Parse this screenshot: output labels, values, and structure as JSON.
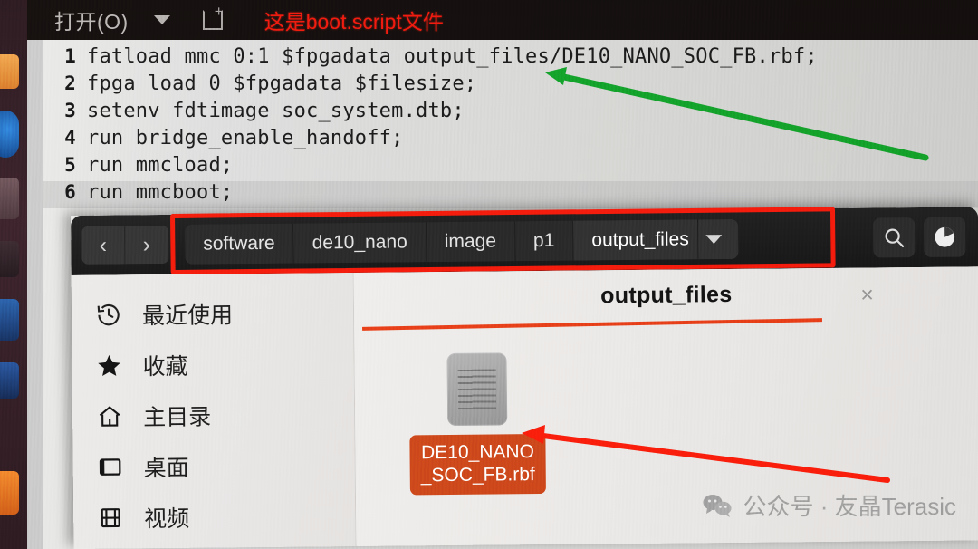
{
  "editor": {
    "toolbar": {
      "open_label": "打开(O)",
      "dropdown_icon": "chevron-down-icon",
      "new_document_icon": "new-document-icon"
    },
    "annotation_title": "这是boot.script文件",
    "code_lines": [
      {
        "num": "1",
        "text": "fatload mmc 0:1 $fpgadata output_files/DE10_NANO_SOC_FB.rbf;"
      },
      {
        "num": "2",
        "text": "fpga load 0 $fpgadata $filesize;"
      },
      {
        "num": "3",
        "text": "setenv fdtimage soc_system.dtb;"
      },
      {
        "num": "4",
        "text": "run bridge_enable_handoff;"
      },
      {
        "num": "5",
        "text": "run mmcload;"
      },
      {
        "num": "6",
        "text": "run mmcboot;"
      }
    ]
  },
  "filemanager": {
    "nav": {
      "back_icon": "chevron-left-icon",
      "back_label": "‹",
      "forward_icon": "chevron-right-icon",
      "forward_label": "›"
    },
    "breadcrumb": [
      {
        "label": "software",
        "current": false
      },
      {
        "label": "de10_nano",
        "current": false
      },
      {
        "label": "image",
        "current": false
      },
      {
        "label": "p1",
        "current": false
      },
      {
        "label": "output_files",
        "current": true
      }
    ],
    "breadcrumb_dropdown_icon": "chevron-down-icon",
    "header_actions": [
      {
        "name": "search-icon",
        "label": "search"
      },
      {
        "name": "view-options-icon",
        "label": "view-options"
      }
    ],
    "sidebar": [
      {
        "icon": "recent-clock-icon",
        "label": "最近使用"
      },
      {
        "icon": "star-icon",
        "label": "收藏"
      },
      {
        "icon": "home-icon",
        "label": "主目录"
      },
      {
        "icon": "desktop-icon",
        "label": "桌面"
      },
      {
        "icon": "video-film-icon",
        "label": "视频"
      }
    ],
    "content": {
      "title": "output_files",
      "close_icon": "close-icon",
      "close_label": "×",
      "file": {
        "icon": "text-file-icon",
        "name": "DE10_NANO_SOC_FB.rbf",
        "label_lines": "DE10_NANO_SOC_FB.rbf"
      }
    }
  },
  "annotations": {
    "box_color": "#f51d0d",
    "green_arrow_color": "#14a52c",
    "red_arrow_color": "#fa1f0c",
    "underline_color": "#e8411a"
  },
  "watermark": {
    "icon": "wechat-icon",
    "text": "公众号 · 友晶Terasic"
  }
}
